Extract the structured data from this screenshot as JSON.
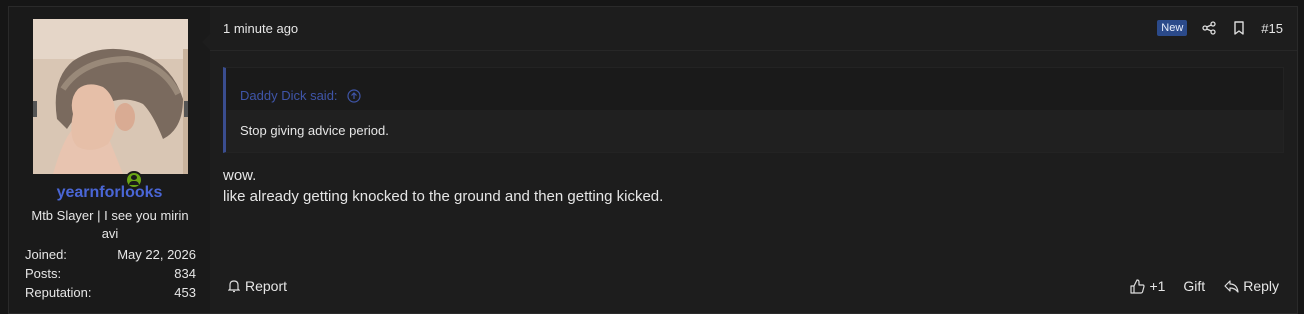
{
  "user": {
    "username": "yearnforlooks",
    "title": "Mtb Slayer | I see you mirin avi",
    "online": true,
    "stats": [
      {
        "label": "Joined:",
        "value": "May 22, 2026"
      },
      {
        "label": "Posts:",
        "value": "834"
      },
      {
        "label": "Reputation:",
        "value": "453"
      }
    ]
  },
  "post": {
    "timestamp": "1 minute ago",
    "new_badge": "New",
    "number": "#15",
    "quote": {
      "author": "Daddy Dick said:",
      "text": "Stop giving advice period."
    },
    "message_lines": [
      "wow.",
      "like already getting knocked to the ground and then getting kicked."
    ]
  },
  "footer": {
    "report": "Report",
    "like_count": "+1",
    "gift": "Gift",
    "reply": "Reply"
  },
  "colors": {
    "username": "#4a66d6",
    "quote_author": "#3f55a8",
    "badge": "#2b4a8a",
    "online": "#6aa516"
  },
  "icons": [
    "share-icon",
    "bookmark-icon",
    "arrow-up-circle-icon",
    "bell-icon",
    "thumbs-up-icon",
    "reply-icon",
    "online-user-icon"
  ]
}
